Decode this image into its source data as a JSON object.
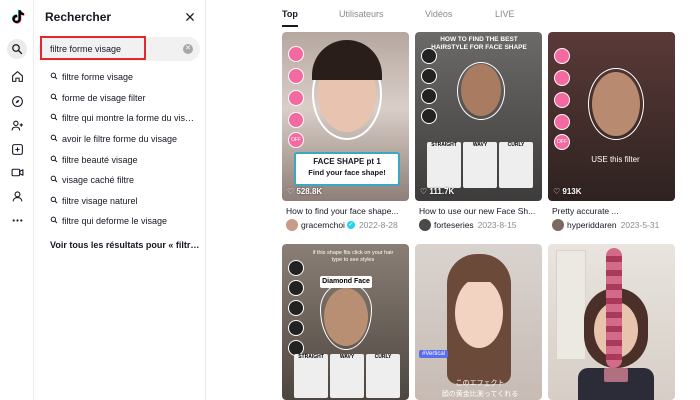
{
  "search_panel": {
    "title": "Rechercher",
    "query": "filtre forme visage",
    "suggestions": [
      "filtre forme visage",
      "forme de visage filter",
      "filtre qui montre la forme du visage",
      "avoir le filtre forme du visage",
      "filtre beauté visage",
      "visage caché filtre",
      "filtre visage naturel",
      "filtre qui deforme le visage"
    ],
    "see_all": "Voir tous les résultats pour « filtre forme visage »"
  },
  "tabs": [
    "Top",
    "Utilisateurs",
    "Vidéos",
    "LIVE"
  ],
  "videos": [
    {
      "likes": "528.8K",
      "caption": "FACE SHAPE pt 1",
      "caption2": "Find your face shape!",
      "title": "How to find your face shape...",
      "user": "gracemchoi",
      "verified": true,
      "date": "2022-8-28"
    },
    {
      "likes": "111.7K",
      "caption": "HOW TO FIND THE BEST HAIRSTYLE FOR FACE SHAPE",
      "labels": [
        "STRAIGHT",
        "WAVY",
        "CURLY"
      ],
      "title": "How to use our new Face Sh...",
      "user": "forteseries",
      "verified": false,
      "date": "2023-8-15"
    },
    {
      "likes": "913K",
      "caption": "USE this filter",
      "title": "Pretty accurate ...",
      "user": "hyperiddaren",
      "verified": false,
      "date": "2023-5-31"
    },
    {
      "caption": "if this shape fits click on your hair type to see styles",
      "caption2": "Diamond Face",
      "labels": [
        "STRAIGHT",
        "WAVY",
        "CURLY"
      ]
    },
    {
      "caption": "このエフェクト",
      "caption2": "顔の黄金比測ってくれる",
      "tag": "#Vertical"
    },
    {}
  ],
  "colors": {
    "accent": "#fe2c55",
    "highlight": "#e0282e",
    "pink": "#f46aa0"
  }
}
